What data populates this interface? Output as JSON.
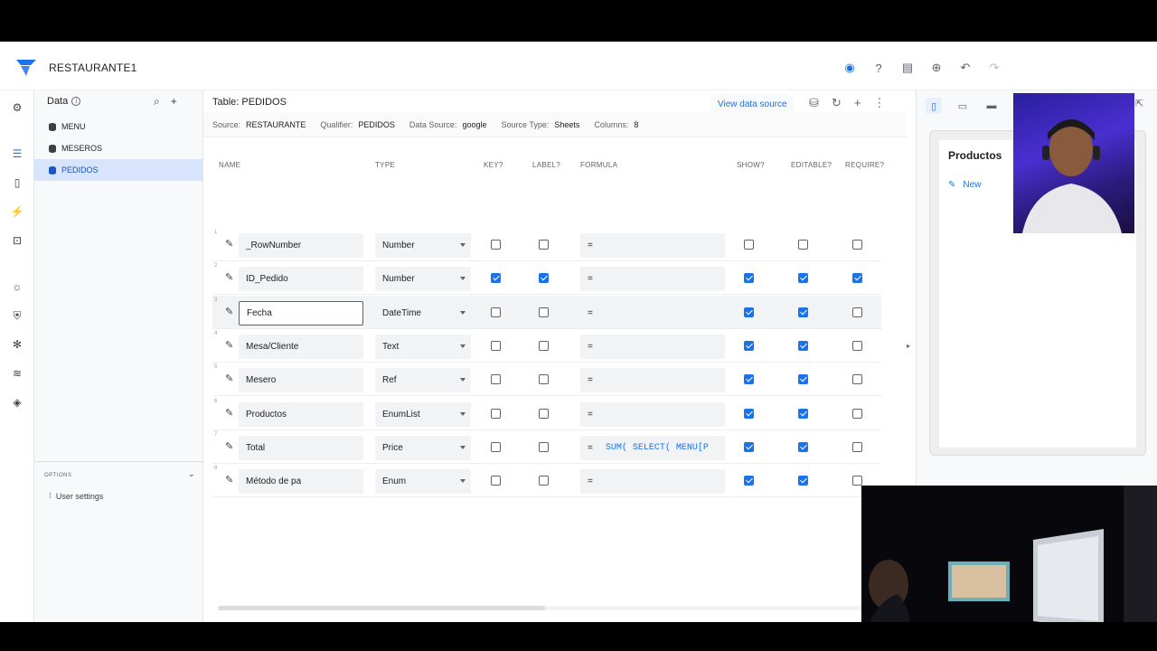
{
  "app": {
    "name": "RESTAURANTE1"
  },
  "sidebar": {
    "title": "Data",
    "items": [
      {
        "label": "MENU"
      },
      {
        "label": "MESEROS"
      },
      {
        "label": "PEDIDOS"
      }
    ],
    "options_label": "OPTIONS",
    "user_settings": "User settings"
  },
  "main": {
    "table_title": "Table: PEDIDOS",
    "view_data_source": "View data source",
    "meta": {
      "source_label": "Source:",
      "source": "RESTAURANTE",
      "qualifier_label": "Qualifier:",
      "qualifier": "PEDIDOS",
      "datasource_label": "Data Source:",
      "datasource": "google",
      "sourcetype_label": "Source Type:",
      "sourcetype": "Sheets",
      "columns_label": "Columns:",
      "columns": "8"
    },
    "headers": {
      "name": "NAME",
      "type": "TYPE",
      "key": "KEY?",
      "label": "LABEL?",
      "formula": "FORMULA",
      "show": "SHOW?",
      "editable": "EDITABLE?",
      "require": "REQUIRE?"
    },
    "rows": [
      {
        "num": "1",
        "name": "_RowNumber",
        "type": "Number",
        "key": false,
        "label": false,
        "formula": "=",
        "code": "",
        "show": false,
        "editable": false,
        "require": false
      },
      {
        "num": "2",
        "name": "ID_Pedido",
        "type": "Number",
        "key": true,
        "label": true,
        "formula": "=",
        "code": "",
        "show": true,
        "editable": true,
        "require": true
      },
      {
        "num": "3",
        "name": "Fecha",
        "type": "DateTime",
        "key": false,
        "label": false,
        "formula": "=",
        "code": "",
        "show": true,
        "editable": true,
        "require": false
      },
      {
        "num": "4",
        "name": "Mesa/Cliente",
        "type": "Text",
        "key": false,
        "label": false,
        "formula": "=",
        "code": "",
        "show": true,
        "editable": true,
        "require": false
      },
      {
        "num": "5",
        "name": "Mesero",
        "type": "Ref",
        "key": false,
        "label": false,
        "formula": "=",
        "code": "",
        "show": true,
        "editable": true,
        "require": false
      },
      {
        "num": "6",
        "name": "Productos",
        "type": "EnumList",
        "key": false,
        "label": false,
        "formula": "=",
        "code": "",
        "show": true,
        "editable": true,
        "require": false
      },
      {
        "num": "7",
        "name": "Total",
        "type": "Price",
        "key": false,
        "label": false,
        "formula": "=",
        "code": "SUM( SELECT( MENU[P",
        "show": true,
        "editable": true,
        "require": false
      },
      {
        "num": "8",
        "name": "Método de pa",
        "type": "Enum",
        "key": false,
        "label": false,
        "formula": "=",
        "code": "",
        "show": true,
        "editable": true,
        "require": false
      }
    ]
  },
  "preview": {
    "title": "Productos",
    "new_label": "New"
  },
  "icons": [
    "logo-icon",
    "eye-icon",
    "help-icon",
    "library-icon",
    "share-icon",
    "undo-icon",
    "redo-icon",
    "search-icon",
    "add-icon",
    "database-icon",
    "refresh-icon",
    "more-icon",
    "pencil-icon",
    "phone-icon",
    "tablet-icon",
    "desktop-icon",
    "open-external-icon"
  ],
  "colors": {
    "accent": "#1a73e8",
    "selected_bg": "#d7e4fb"
  }
}
